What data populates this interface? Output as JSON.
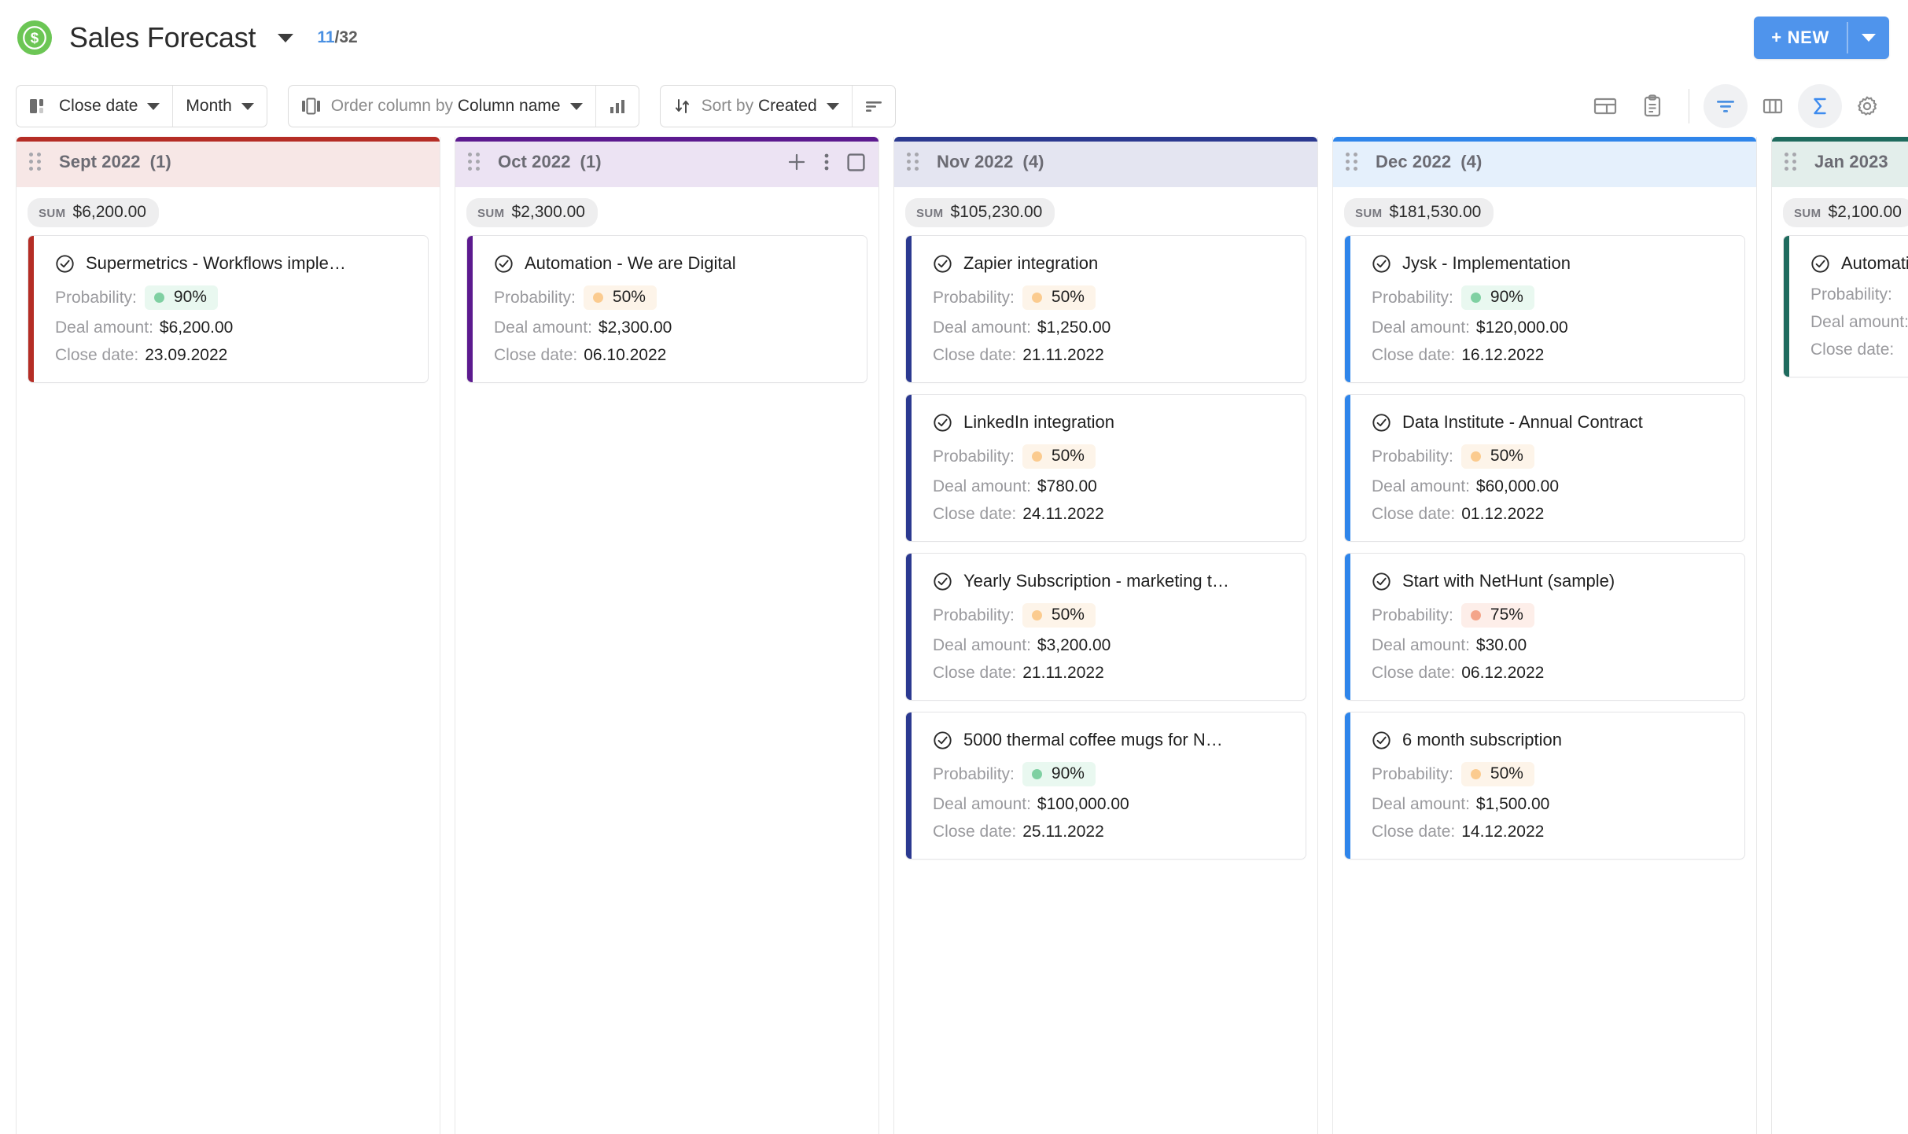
{
  "header": {
    "board_icon": "dollar-folder-icon",
    "title": "Sales Forecast",
    "title_caret": "chevron-down-icon",
    "counter_current": "11",
    "counter_sep": "/",
    "counter_total": "32",
    "new_button_label": "+ NEW",
    "new_button_caret": "chevron-down-icon",
    "accent_color": "#4f94ec",
    "logo_color": "#6cc655"
  },
  "toolbar": {
    "group_by_icon": "columns-icon",
    "group_by_field": "Close date",
    "group_by_caret": "chevron-down-icon",
    "group_by_period": "Month",
    "group_by_period_caret": "chevron-down-icon",
    "order_icon": "reorder-columns-icon",
    "order_label_prefix": "Order column by ",
    "order_label_value": "Column name",
    "order_caret": "chevron-down-icon",
    "order_chart_icon": "bar-chart-icon",
    "sort_icon": "sort-arrows-icon",
    "sort_label_prefix": "Sort by ",
    "sort_label_value": "Created",
    "sort_caret": "chevron-down-icon",
    "sort_direction_icon": "sort-descending-icon",
    "right_icons": [
      {
        "name": "layout-split-icon",
        "active": false
      },
      {
        "name": "clipboard-icon",
        "active": false
      },
      {
        "name": "filter-icon",
        "active": true
      },
      {
        "name": "columns-view-icon",
        "active": false
      },
      {
        "name": "sum-sigma-icon",
        "active": true
      },
      {
        "name": "gear-icon",
        "active": false
      }
    ],
    "filter_icon_color": "#4a90e2",
    "sigma_icon_color": "#4a90e2"
  },
  "board": {
    "sum_label": "SUM",
    "probability_label": "Probability:",
    "deal_amount_label": "Deal amount:",
    "close_date_label": "Close date:",
    "columns": [
      {
        "title": "Sept 2022",
        "count": "(1)",
        "sum": "$6,200.00",
        "accent": "#b52d25",
        "head_bg": "#f7e7e6",
        "show_actions": false,
        "cards": [
          {
            "title": "Supermetrics - Workflows imple…",
            "probability": "90%",
            "prob_dot": "#7fd0a2",
            "prob_bg": "#e9f8f0",
            "deal_amount": "$6,200.00",
            "close_date": "23.09.2022",
            "stripe": "#b52d25"
          }
        ]
      },
      {
        "title": "Oct 2022",
        "count": "(1)",
        "sum": "$2,300.00",
        "accent": "#5c1a8f",
        "head_bg": "#ece3f3",
        "show_actions": true,
        "actions": {
          "add": "plus-icon",
          "more": "more-vertical-icon",
          "collapse": "collapse-column-icon"
        },
        "cards": [
          {
            "title": "Automation - We are Digital",
            "probability": "50%",
            "prob_dot": "#fbcb8f",
            "prob_bg": "#fdf4e9",
            "deal_amount": "$2,300.00",
            "close_date": "06.10.2022",
            "stripe": "#5c1a8f"
          }
        ]
      },
      {
        "title": "Nov 2022",
        "count": "(4)",
        "sum": "$105,230.00",
        "accent": "#2b3990",
        "head_bg": "#e4e5f1",
        "show_actions": false,
        "cards": [
          {
            "title": "Zapier integration",
            "probability": "50%",
            "prob_dot": "#fbcb8f",
            "prob_bg": "#fdf4e9",
            "deal_amount": "$1,250.00",
            "close_date": "21.11.2022",
            "stripe": "#2b3990"
          },
          {
            "title": "LinkedIn integration",
            "probability": "50%",
            "prob_dot": "#fbcb8f",
            "prob_bg": "#fdf4e9",
            "deal_amount": "$780.00",
            "close_date": "24.11.2022",
            "stripe": "#2b3990"
          },
          {
            "title": "Yearly Subscription - marketing t…",
            "probability": "50%",
            "prob_dot": "#fbcb8f",
            "prob_bg": "#fdf4e9",
            "deal_amount": "$3,200.00",
            "close_date": "21.11.2022",
            "stripe": "#2b3990"
          },
          {
            "title": "5000 thermal coffee mugs for N…",
            "probability": "90%",
            "prob_dot": "#7fd0a2",
            "prob_bg": "#e9f8f0",
            "deal_amount": "$100,000.00",
            "close_date": "25.11.2022",
            "stripe": "#2b3990"
          }
        ]
      },
      {
        "title": "Dec 2022",
        "count": "(4)",
        "sum": "$181,530.00",
        "accent": "#2f85ea",
        "head_bg": "#e5f0fc",
        "show_actions": false,
        "cards": [
          {
            "title": "Jysk - Implementation",
            "probability": "90%",
            "prob_dot": "#7fd0a2",
            "prob_bg": "#e9f8f0",
            "deal_amount": "$120,000.00",
            "close_date": "16.12.2022",
            "stripe": "#2f85ea"
          },
          {
            "title": "Data Institute - Annual Contract",
            "probability": "50%",
            "prob_dot": "#fbcb8f",
            "prob_bg": "#fdf4e9",
            "deal_amount": "$60,000.00",
            "close_date": "01.12.2022",
            "stripe": "#2f85ea"
          },
          {
            "title": "Start with NetHunt (sample)",
            "probability": "75%",
            "prob_dot": "#f4a58a",
            "prob_bg": "#fdeee9",
            "deal_amount": "$30.00",
            "close_date": "06.12.2022",
            "stripe": "#2f85ea"
          },
          {
            "title": "6 month subscription",
            "probability": "50%",
            "prob_dot": "#fbcb8f",
            "prob_bg": "#fdf4e9",
            "deal_amount": "$1,500.00",
            "close_date": "14.12.2022",
            "stripe": "#2f85ea"
          }
        ]
      },
      {
        "title": "Jan 2023",
        "count": "",
        "sum": "$2,100.00",
        "accent": "#1f6b5e",
        "head_bg": "#e3eeeb",
        "show_actions": false,
        "cards": [
          {
            "title": "Automation",
            "probability": "",
            "prob_dot": "#fbcb8f",
            "prob_bg": "#fdf4e9",
            "deal_amount": "",
            "close_date": "",
            "stripe": "#1f6b5e"
          }
        ]
      }
    ]
  }
}
